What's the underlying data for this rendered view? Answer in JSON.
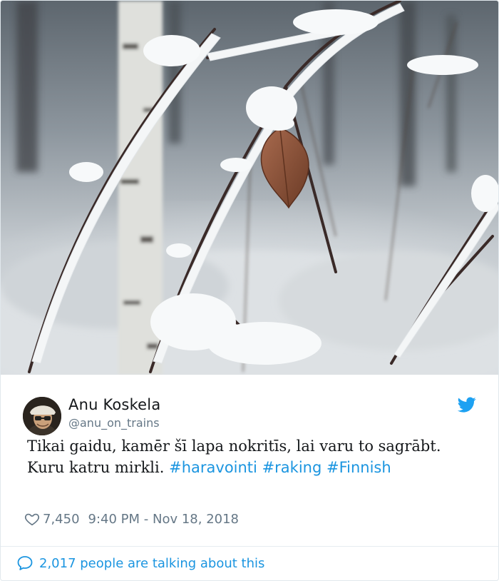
{
  "tweet": {
    "author_name": "Anu Koskela",
    "author_handle": "@anu_on_trains",
    "text_plain": "Tikai gaidu, kamēr šī lapa nokritīs, lai varu to sagrābt. Kuru katru mirkli.",
    "hashtags": [
      "#haravointi",
      "#raking",
      "#Finnish"
    ],
    "likes": "7,450",
    "timestamp": "9:40 PM - Nov 18, 2018",
    "conversation": "2,017 people are talking about this"
  },
  "icons": {
    "platform": "twitter-bird-icon",
    "like": "heart-icon",
    "reply": "speech-bubble-icon"
  },
  "colors": {
    "accent": "#1b95e0",
    "text": "#14171a",
    "muted": "#657786",
    "border": "#e1e8ed",
    "twitter_blue": "#1da1f2"
  }
}
